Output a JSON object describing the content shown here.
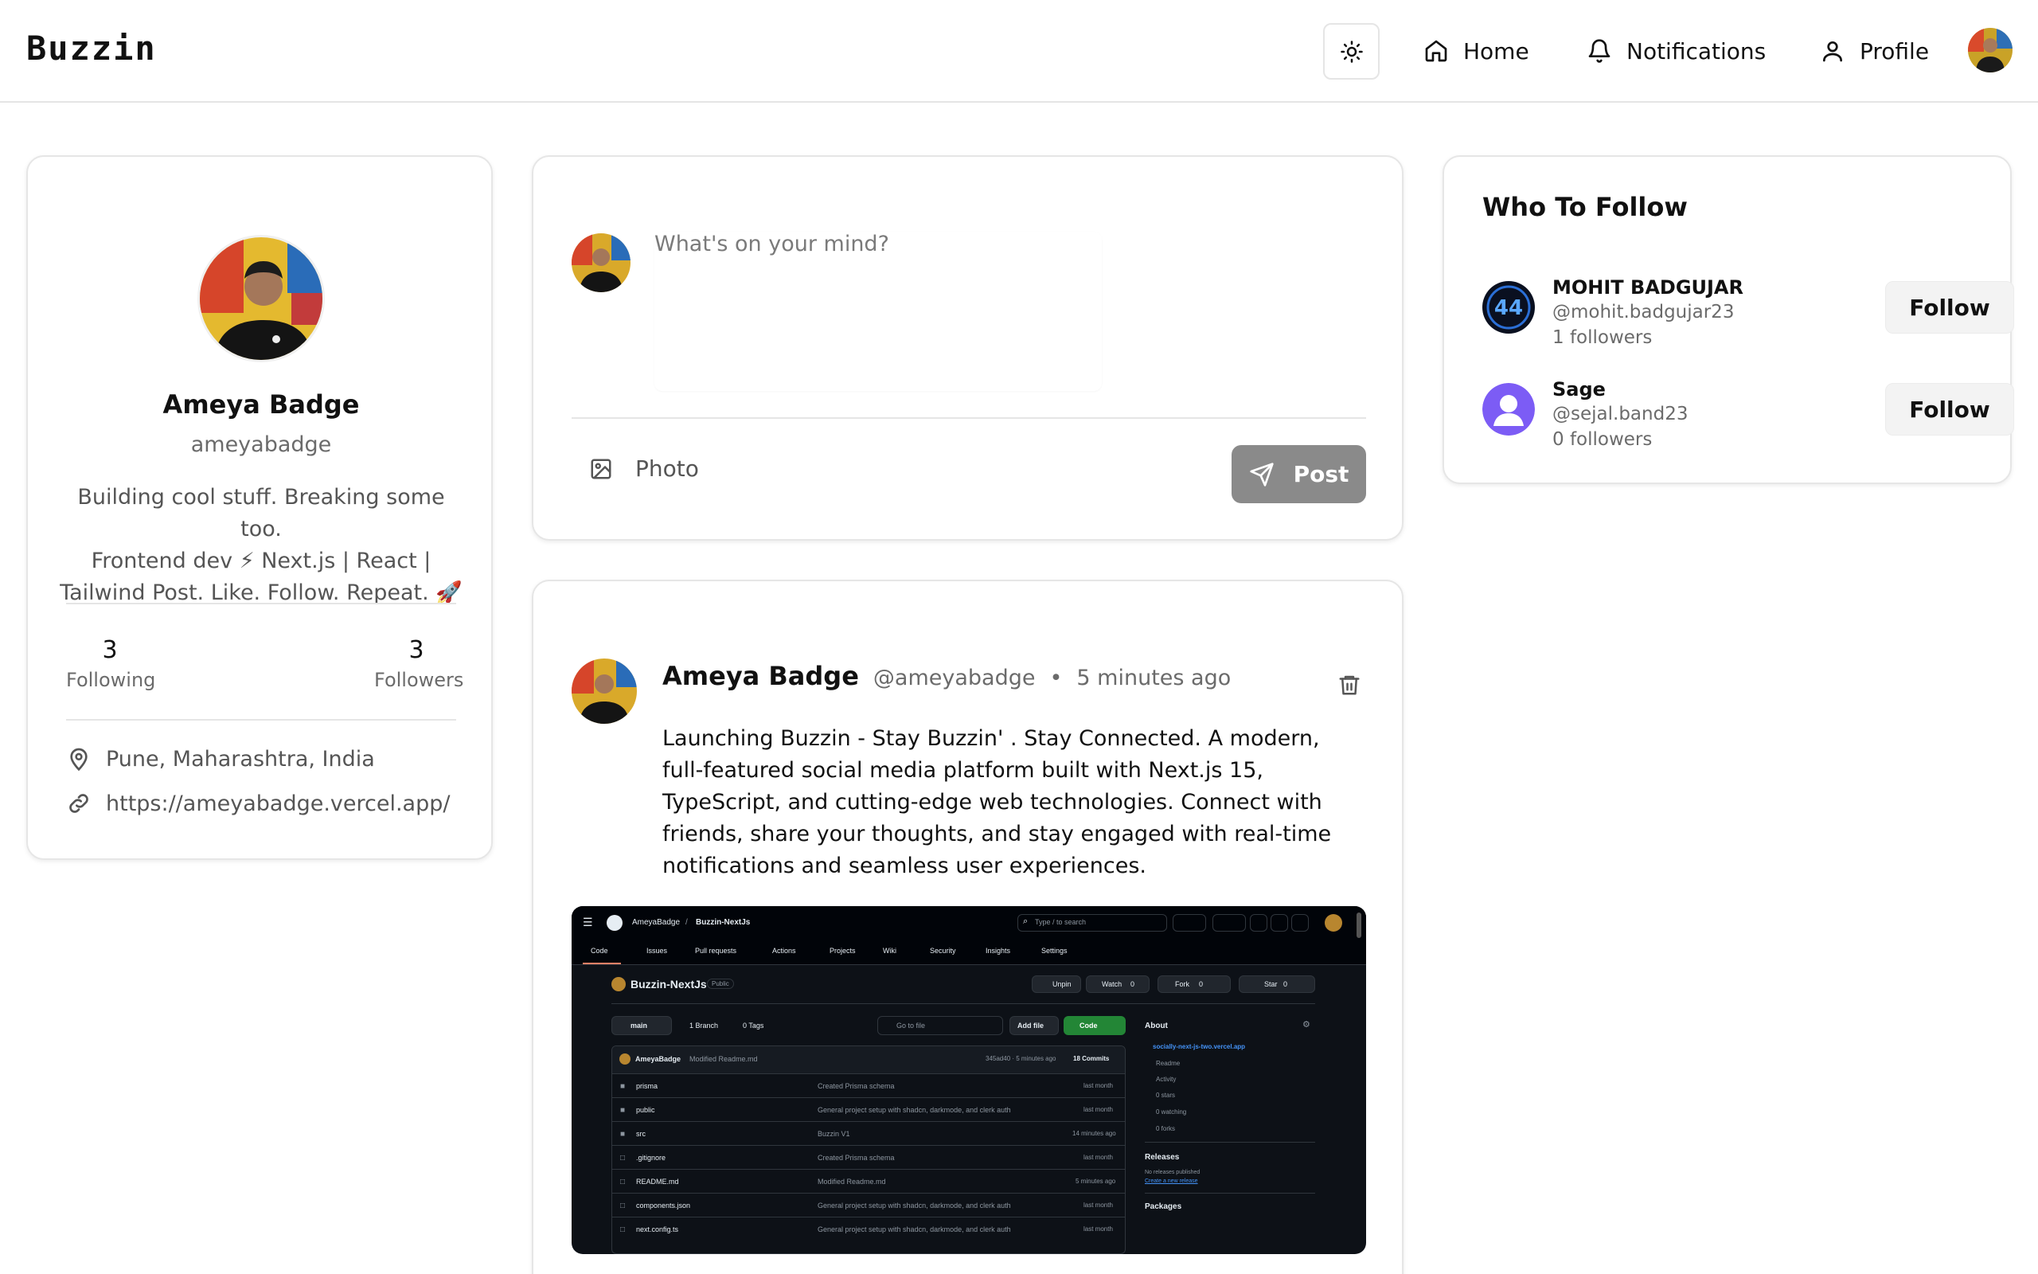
{
  "navbar": {
    "brand": "Buzzin",
    "items": [
      {
        "label": "Home",
        "icon": "home-icon"
      },
      {
        "label": "Notifications",
        "icon": "bell-icon"
      },
      {
        "label": "Profile",
        "icon": "user-icon"
      }
    ]
  },
  "profile": {
    "name": "Ameya Badge",
    "username": "ameyabadge",
    "bio_line1": "Building cool stuff. Breaking some too.",
    "bio_line2": "Frontend dev ⚡ Next.js | React |",
    "bio_line3": "Tailwind Post. Like. Follow. Repeat. 🚀",
    "following_count": "3",
    "following_label": "Following",
    "followers_count": "3",
    "followers_label": "Followers",
    "location": "Pune, Maharashtra, India",
    "website": "https://ameyabadge.vercel.app/"
  },
  "compose": {
    "placeholder": "What's on your mind?",
    "photo_label": "Photo",
    "post_label": "Post"
  },
  "post": {
    "author": "Ameya Badge",
    "handle": "@ameyabadge",
    "separator": "•",
    "time": "5 minutes ago",
    "text": "Launching Buzzin - Stay Buzzin' . Stay Connected. A modern, full-featured social media platform built with Next.js 15, TypeScript, and cutting-edge web technologies. Connect with friends, share your thoughts, and stay engaged with real-time notifications and seamless user experiences."
  },
  "who_to_follow": {
    "title": "Who To Follow",
    "users": [
      {
        "name": "MOHIT BADGUJAR",
        "handle": "@mohit.badgujar23",
        "followers": "1 followers",
        "button": "Follow"
      },
      {
        "name": "Sage",
        "handle": "@sejal.band23",
        "followers": "0 followers",
        "button": "Follow"
      }
    ]
  },
  "github": {
    "owner": "AmeyaBadge",
    "slash": "/",
    "repo": "Buzzin-NextJs",
    "search": "Type / to search",
    "tabs": [
      "Code",
      "Issues",
      "Pull requests",
      "Actions",
      "Projects",
      "Wiki",
      "Security",
      "Insights",
      "Settings"
    ],
    "repo_title": "Buzzin-NextJs",
    "visibility": "Public",
    "unpin": "Unpin",
    "watch": "Watch",
    "watch_count": "0",
    "fork": "Fork",
    "fork_count": "0",
    "star": "Star",
    "star_count": "0",
    "branch": "main",
    "branches": "1 Branch",
    "tags": "0 Tags",
    "goto_file": "Go to file",
    "add_file": "Add file",
    "code_btn": "Code",
    "commit_author": "AmeyaBadge",
    "commit_msg": "Modified Readme.md",
    "commit_meta": "345ad40 · 5 minutes ago",
    "commits": "18 Commits",
    "files": [
      {
        "name": "prisma",
        "msg": "Created Prisma schema",
        "time": "last month",
        "type": "dir"
      },
      {
        "name": "public",
        "msg": "General project setup with shadcn, darkmode, and clerk auth",
        "time": "last month",
        "type": "dir"
      },
      {
        "name": "src",
        "msg": "Buzzin V1",
        "time": "14 minutes ago",
        "type": "dir"
      },
      {
        "name": ".gitignore",
        "msg": "Created Prisma schema",
        "time": "last month",
        "type": "file"
      },
      {
        "name": "README.md",
        "msg": "Modified Readme.md",
        "time": "5 minutes ago",
        "type": "file"
      },
      {
        "name": "components.json",
        "msg": "General project setup with shadcn, darkmode, and clerk auth",
        "time": "last month",
        "type": "file"
      },
      {
        "name": "next.config.ts",
        "msg": "General project setup with shadcn, darkmode, and clerk auth",
        "time": "last month",
        "type": "file"
      }
    ],
    "about_title": "About",
    "about_link": "socially-next-js-two.vercel.app",
    "about_items": [
      "Readme",
      "Activity",
      "0 stars",
      "0 watching",
      "0 forks"
    ],
    "releases_title": "Releases",
    "releases_none": "No releases published",
    "releases_link": "Create a new release",
    "packages_title": "Packages"
  },
  "colors": {
    "post_button": "#8a8a8a",
    "follow_button": "#f3f3f3",
    "border": "#e5e5e5",
    "github_bg": "#0d1117",
    "github_green": "#238636"
  }
}
